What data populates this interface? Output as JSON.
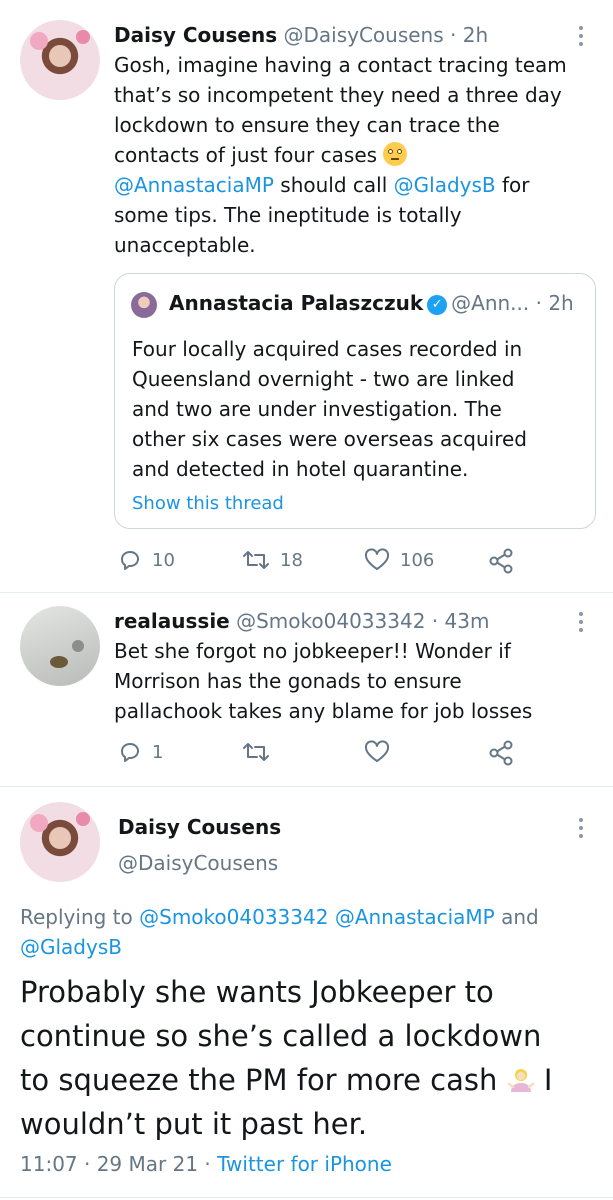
{
  "tweet1": {
    "author_name": "Daisy Cousens",
    "handle": "@DaisyCousens",
    "time": "· 2h",
    "lines": [
      "Gosh, imagine having a contact tracing team",
      "that’s so incompetent they need a three day",
      "lockdown to ensure they can trace the",
      "contacts of just four cases"
    ],
    "mention1": "@AnnastaciaMP",
    "mid_text1": " should call ",
    "mention2": "@GladysB",
    "mid_text2": " for",
    "line6": "some tips. The ineptitude is totally",
    "line7": "unacceptable.",
    "quoted": {
      "author_name": "Annastacia Palaszczuk",
      "handle": "@Ann...",
      "time": "· 2h",
      "lines": [
        "Four locally acquired cases recorded in",
        "Queensland overnight - two are linked",
        "and two are under investigation. The",
        "other six cases were overseas acquired",
        "and detected in hotel quarantine."
      ],
      "show_thread": "Show this thread"
    },
    "replies": "10",
    "retweets": "18",
    "likes": "106"
  },
  "tweet2": {
    "author_name": "realaussie",
    "handle": "@Smoko04033342 · 43m",
    "lines": [
      "Bet she forgot no jobkeeper!! Wonder if",
      "Morrison has the gonads to ensure",
      "pallachook takes any blame for job losses"
    ],
    "replies": "1"
  },
  "tweet3": {
    "author_name": "Daisy Cousens",
    "handle": "@DaisyCousens",
    "replying_prefix": "Replying to ",
    "replying_mention1": "@Smoko04033342",
    "replying_mention2": "@AnnastaciaMP",
    "replying_and": " and",
    "replying_mention3": "@GladysB",
    "lines": [
      "Probably she wants Jobkeeper to",
      "continue so she’s called a lockdown",
      "to squeeze the PM for more cash",
      "wouldn’t put it past her."
    ],
    "line3_tail": "I",
    "time": "11:07 · 29 Mar 21 · ",
    "source": "Twitter for iPhone"
  },
  "colors": {
    "link": "#1b95e0",
    "muted": "#657786",
    "verified": "#1da1f2"
  },
  "icons": [
    "more-icon",
    "reply-icon",
    "retweet-icon",
    "like-icon",
    "share-icon",
    "verified-icon"
  ]
}
